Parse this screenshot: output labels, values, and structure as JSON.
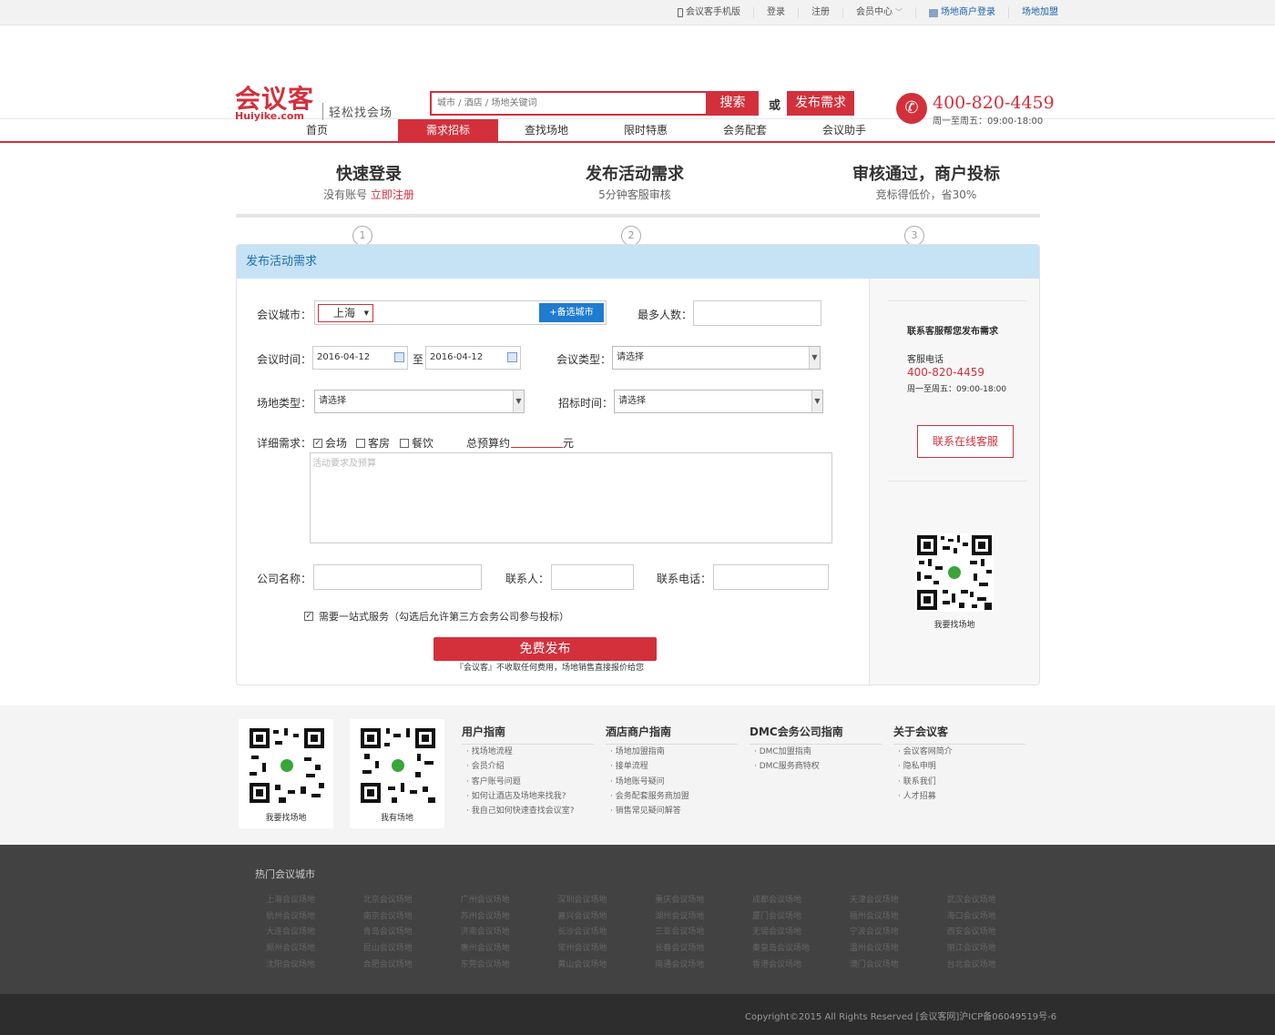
{
  "topbar": {
    "mobile": "会议客手机版",
    "login": "登录",
    "register": "注册",
    "member": "会员中心",
    "merchant_login": "场地商户登录",
    "join": "场地加盟"
  },
  "header": {
    "logo_cn": "会议客",
    "logo_en": "Huiyike.com",
    "slogan": "轻松找会场",
    "search_placeholder": "城市 / 酒店 / 场地关键词",
    "search_btn": "搜索",
    "or": "或",
    "publish_btn": "发布需求",
    "phone": "400-820-4459",
    "phone_time": "周一至周五：09:00-18:00"
  },
  "nav": [
    "首页",
    "需求招标",
    "查找场地",
    "限时特惠",
    "会务配套",
    "会议助手"
  ],
  "steps": [
    {
      "title": "快速登录",
      "sub_a": "没有账号 ",
      "sub_b": "立即注册",
      "num": "1"
    },
    {
      "title": "发布活动需求",
      "sub": "5分钟客服审核",
      "num": "2"
    },
    {
      "title": "审核通过，商户投标",
      "sub": "竞标得低价，省30%",
      "num": "3"
    }
  ],
  "panel": {
    "title": "发布活动需求",
    "city_label": "会议城市：",
    "city_value": "上海",
    "city_btn": "+备选城市",
    "max_people_label": "最多人数：",
    "time_label": "会议时间：",
    "date_from": "2016-04-12",
    "date_to_label": "至",
    "date_to": "2016-04-12",
    "type_label": "会议类型：",
    "type_value": "请选择",
    "venue_type_label": "场地类型：",
    "venue_type_value": "请选择",
    "bid_time_label": "招标时间：",
    "bid_time_value": "请选择",
    "detail_label": "详细需求：",
    "opt_venue": "会场",
    "opt_room": "客房",
    "opt_food": "餐饮",
    "budget_label": "总预算约",
    "budget_unit": "元",
    "textarea_placeholder": "活动要求及预算",
    "company_label": "公司名称：",
    "contact_label": "联系人：",
    "contact_phone_label": "联系电话：",
    "one_stop": "需要一站式服务（勾选后允许第三方会务公司参与投标）",
    "free_btn": "免费发布",
    "note": "『会议客』不收取任何费用，场地销售直接报价给您"
  },
  "side": {
    "title": "联系客服帮您发布需求",
    "tel_label": "客服电话",
    "tel": "400-820-4459",
    "tel_time": "周一至周五：09:00-18:00",
    "online_btn": "联系在线客服",
    "qr_caption": "我要找场地"
  },
  "footer": {
    "qr1": "我要找场地",
    "qr2": "我有场地",
    "cols": [
      {
        "title": "用户指南",
        "items": [
          "找场地流程",
          "会员介绍",
          "客户账号问题",
          "如何让酒店及场地来找我?",
          "我自己如何快速查找会议室?"
        ]
      },
      {
        "title": "酒店商户指南",
        "items": [
          "场地加盟指南",
          "接单流程",
          "场地账号疑问",
          "会务配套服务商加盟",
          "销售常见疑问解答"
        ]
      },
      {
        "title": "DMC会务公司指南",
        "items": [
          "DMC加盟指南",
          "DMC服务商特权"
        ]
      },
      {
        "title": "关于会议客",
        "items": [
          "会议客网简介",
          "隐私申明",
          "联系我们",
          "人才招募"
        ]
      }
    ]
  },
  "hot": {
    "title": "热门会议城市",
    "cities": [
      [
        "上海会议场地",
        "北京会议场地",
        "广州会议场地",
        "深圳会议场地",
        "重庆会议场地",
        "成都会议场地",
        "天津会议场地",
        "武汉会议场地"
      ],
      [
        "杭州会议场地",
        "南京会议场地",
        "苏州会议场地",
        "嘉兴会议场地",
        "湖州会议场地",
        "厦门会议场地",
        "福州会议场地",
        "海口会议场地"
      ],
      [
        "大连会议场地",
        "青岛会议场地",
        "济南会议场地",
        "长沙会议场地",
        "三亚会议场地",
        "无锡会议场地",
        "宁波会议场地",
        "西安会议场地"
      ],
      [
        "郑州会议场地",
        "昆山会议场地",
        "惠州会议场地",
        "常州会议场地",
        "长春会议场地",
        "秦皇岛会议场地",
        "温州会议场地",
        "丽江会议场地"
      ],
      [
        "沈阳会议场地",
        "合肥会议场地",
        "东莞会议场地",
        "黄山会议场地",
        "南通会议场地",
        "香港会议场地",
        "澳门会议场地",
        "台北会议场地"
      ]
    ]
  },
  "copyright": "Copyright©2015 All Rights Reserved [会议客网]沪ICP备06049519号-6",
  "colors": {
    "brand": "#d3303c",
    "blue": "#1f7ccf",
    "panel_head": "#c6e2f5"
  }
}
